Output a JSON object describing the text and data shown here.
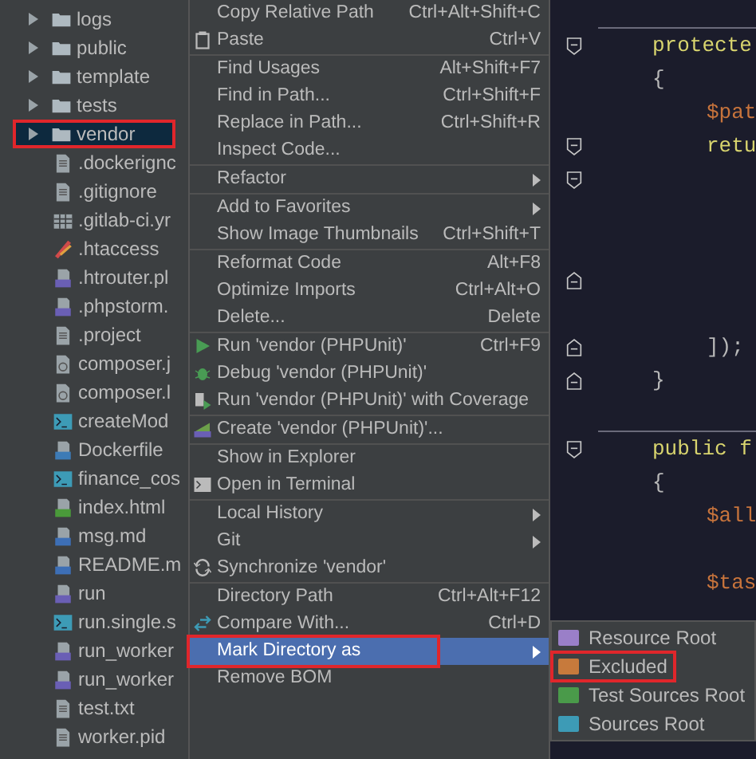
{
  "project_tree": [
    {
      "label": "logs",
      "kind": "folder",
      "selected": false,
      "annotated": false
    },
    {
      "label": "public",
      "kind": "folder",
      "selected": false,
      "annotated": false
    },
    {
      "label": "template",
      "kind": "folder",
      "selected": false,
      "annotated": false
    },
    {
      "label": "tests",
      "kind": "folder",
      "selected": false,
      "annotated": false
    },
    {
      "label": "vendor",
      "kind": "folder",
      "selected": true,
      "annotated": true
    },
    {
      "label": ".dockerignc",
      "kind": "text",
      "selected": false,
      "annotated": false
    },
    {
      "label": ".gitignore",
      "kind": "text",
      "selected": false,
      "annotated": false
    },
    {
      "label": ".gitlab-ci.yr",
      "kind": "table",
      "selected": false,
      "annotated": false
    },
    {
      "label": ".htaccess",
      "kind": "config",
      "selected": false,
      "annotated": false
    },
    {
      "label": ".htrouter.pl",
      "kind": "php",
      "selected": false,
      "annotated": false
    },
    {
      "label": ".phpstorm.",
      "kind": "php",
      "selected": false,
      "annotated": false
    },
    {
      "label": ".project",
      "kind": "text",
      "selected": false,
      "annotated": false
    },
    {
      "label": "composer.j",
      "kind": "json",
      "selected": false,
      "annotated": false
    },
    {
      "label": "composer.l",
      "kind": "json",
      "selected": false,
      "annotated": false
    },
    {
      "label": "createMod",
      "kind": "shell",
      "selected": false,
      "annotated": false
    },
    {
      "label": "Dockerfile",
      "kind": "docker",
      "selected": false,
      "annotated": false
    },
    {
      "label": "finance_cos",
      "kind": "shell",
      "selected": false,
      "annotated": false
    },
    {
      "label": "index.html",
      "kind": "html",
      "selected": false,
      "annotated": false
    },
    {
      "label": "msg.md",
      "kind": "md",
      "selected": false,
      "annotated": false
    },
    {
      "label": "README.m",
      "kind": "md",
      "selected": false,
      "annotated": false
    },
    {
      "label": "run",
      "kind": "php",
      "selected": false,
      "annotated": false
    },
    {
      "label": "run.single.s",
      "kind": "shell",
      "selected": false,
      "annotated": false
    },
    {
      "label": "run_worker",
      "kind": "php",
      "selected": false,
      "annotated": false
    },
    {
      "label": "run_worker",
      "kind": "php",
      "selected": false,
      "annotated": false
    },
    {
      "label": "test.txt",
      "kind": "text",
      "selected": false,
      "annotated": false
    },
    {
      "label": "worker.pid",
      "kind": "text",
      "selected": false,
      "annotated": false
    }
  ],
  "context_menu": [
    [
      {
        "label": "Copy Relative Path",
        "shortcut": "Ctrl+Alt+Shift+C"
      },
      {
        "label": "Paste",
        "shortcut": "Ctrl+V",
        "kind": "clipboard"
      }
    ],
    [
      {
        "label": "Find Usages",
        "shortcut": "Alt+Shift+F7"
      },
      {
        "label": "Find in Path...",
        "shortcut": "Ctrl+Shift+F"
      },
      {
        "label": "Replace in Path...",
        "shortcut": "Ctrl+Shift+R"
      },
      {
        "label": "Inspect Code..."
      }
    ],
    [
      {
        "label": "Refactor",
        "submenu": true
      }
    ],
    [
      {
        "label": "Add to Favorites",
        "submenu": true
      },
      {
        "label": "Show Image Thumbnails",
        "shortcut": "Ctrl+Shift+T"
      }
    ],
    [
      {
        "label": "Reformat Code",
        "shortcut": "Alt+F8"
      },
      {
        "label": "Optimize Imports",
        "shortcut": "Ctrl+Alt+O"
      },
      {
        "label": "Delete...",
        "shortcut": "Delete"
      }
    ],
    [
      {
        "label": "Run 'vendor (PHPUnit)'",
        "shortcut": "Ctrl+F9",
        "kind": "run"
      },
      {
        "label": "Debug 'vendor (PHPUnit)'",
        "kind": "debug"
      },
      {
        "label": "Run 'vendor (PHPUnit)' with Coverage",
        "kind": "coverage"
      }
    ],
    [
      {
        "label": "Create 'vendor (PHPUnit)'...",
        "kind": "create"
      }
    ],
    [
      {
        "label": "Show in Explorer"
      },
      {
        "label": "Open in Terminal",
        "kind": "terminal"
      }
    ],
    [
      {
        "label": "Local History",
        "submenu": true
      },
      {
        "label": "Git",
        "submenu": true
      },
      {
        "label": "Synchronize 'vendor'",
        "kind": "sync"
      }
    ],
    [
      {
        "label": "Directory Path",
        "shortcut": "Ctrl+Alt+F12"
      },
      {
        "label": "Compare With...",
        "shortcut": "Ctrl+D",
        "kind": "compare"
      },
      {
        "label": "Mark Directory as",
        "submenu": true,
        "selected": true,
        "annotated": true
      },
      {
        "label": "Remove BOM"
      }
    ]
  ],
  "submenu": [
    {
      "label": "Resource Root",
      "color": "#9a7fc8",
      "annotated": false
    },
    {
      "label": "Excluded",
      "color": "#c77a3c",
      "annotated": true
    },
    {
      "label": "Test Sources Root",
      "color": "#4a9a4a",
      "annotated": false
    },
    {
      "label": "Sources Root",
      "color": "#3d9bb6",
      "annotated": false
    }
  ],
  "code_lines": [
    {
      "text": "protecte",
      "kind": "keyword",
      "fold_start": true,
      "separator": true
    },
    {
      "text": "{",
      "kind": "plain",
      "children": [
        {
          "text": "$pat",
          "kind": "variable"
        },
        {
          "text": "retu",
          "kind": "keyword",
          "fold_start": true
        },
        {
          "kind": "blank",
          "fold_start": true
        },
        {
          "kind": "blank"
        },
        {
          "kind": "blank"
        },
        {
          "kind": "blank",
          "fold_end": true
        },
        {
          "kind": "blank"
        },
        {
          "text": "]);",
          "kind": "plain",
          "fold_end": true
        }
      ]
    },
    {
      "text": "}",
      "kind": "plain",
      "fold_end": true
    },
    {
      "kind": "blank"
    },
    {
      "text": "public f",
      "kind": "keyword",
      "fold_start": true,
      "separator": true
    },
    {
      "text": "{",
      "kind": "plain",
      "children": [
        {
          "text": "$all",
          "kind": "variable"
        },
        {
          "kind": "blank"
        },
        {
          "text": "$tas",
          "kind": "variable"
        }
      ]
    }
  ]
}
